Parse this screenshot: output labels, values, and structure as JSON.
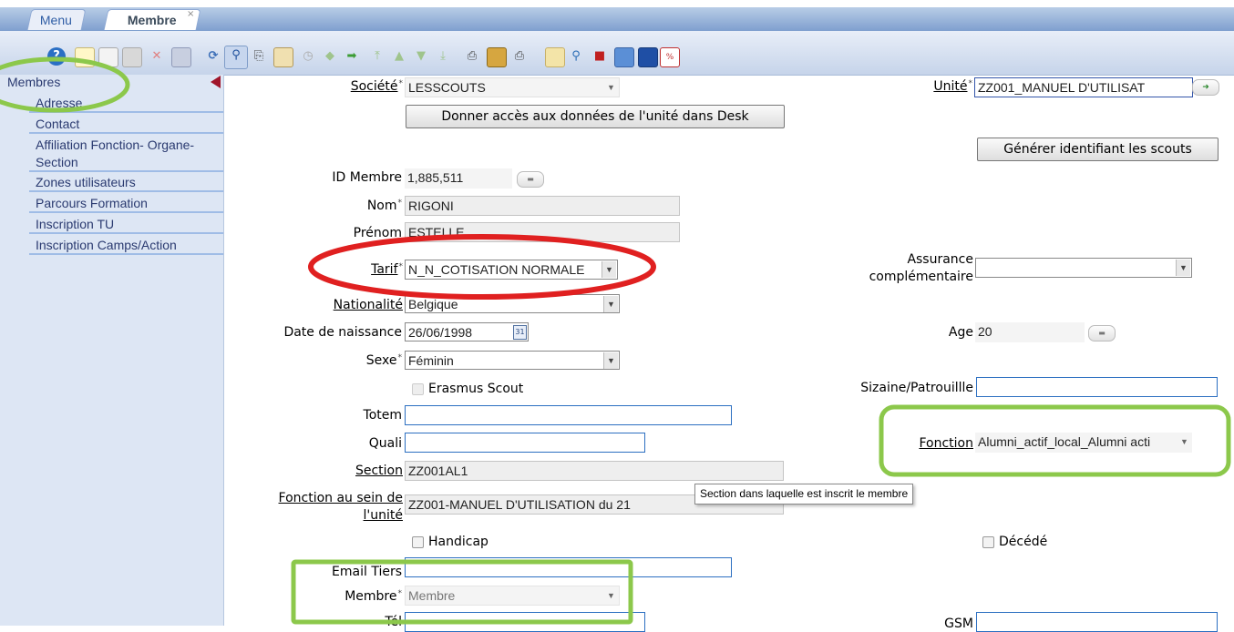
{
  "tabs": {
    "menu": "Menu",
    "active": "Membre",
    "close": "×"
  },
  "toolbar": {
    "icons": [
      "help-icon",
      "new-icon",
      "copy-icon",
      "edit-icon",
      "delete-icon",
      "save-icon",
      "refresh-icon",
      "search-icon",
      "attach-icon",
      "table-icon",
      "clock-icon",
      "prev-icon",
      "next-icon",
      "first-icon",
      "up-icon",
      "down-icon",
      "last-icon",
      "print-icon",
      "report-icon",
      "print2-icon",
      "lock-icon",
      "zoom-icon",
      "export-icon",
      "chart-icon",
      "book-icon",
      "pdf-icon"
    ]
  },
  "sidebar": {
    "header": "Membres",
    "items": [
      "Adresse",
      "Contact",
      "Affiliation Fonction- Organe-",
      "Section",
      "Zones utilisateurs",
      "Parcours Formation",
      "Inscription TU",
      "Inscription Camps/Action"
    ]
  },
  "form": {
    "societe": {
      "label": "Société",
      "value": "LESSCOUTS"
    },
    "unite": {
      "label": "Unité",
      "value": "ZZ001_MANUEL D'UTILISAT"
    },
    "donner_button": "Donner accès aux données de l'unité dans Desk",
    "generer_button": "Générer identifiant les scouts",
    "id_membre": {
      "label": "ID Membre",
      "value": "1,885,511"
    },
    "nom": {
      "label": "Nom",
      "value": "RIGONI"
    },
    "prenom": {
      "label": "Prénom",
      "value": "ESTELLE"
    },
    "tarif": {
      "label": "Tarif",
      "value": "N_N_COTISATION NORMALE"
    },
    "assurance": {
      "label_1": "Assurance",
      "label_2": "complémentaire",
      "value": ""
    },
    "nationalite": {
      "label": "Nationalité",
      "value": "Belgique"
    },
    "date_naissance": {
      "label": "Date de naissance",
      "value": "26/06/1998"
    },
    "age": {
      "label": "Age",
      "value": "20"
    },
    "sexe": {
      "label": "Sexe",
      "value": "Féminin"
    },
    "erasmus": {
      "label": "Erasmus Scout",
      "checked": false
    },
    "sizaine": {
      "label": "Sizaine/Patrouillle",
      "value": ""
    },
    "totem": {
      "label": "Totem",
      "value": ""
    },
    "quali": {
      "label": "Quali",
      "value": ""
    },
    "fonction": {
      "label": "Fonction",
      "value": "Alumni_actif_local_Alumni acti"
    },
    "section": {
      "label": "Section",
      "value": "ZZ001AL1"
    },
    "section_tooltip": "Section dans laquelle est inscrit le membre",
    "fonction_unite": {
      "label_1": "Fonction au sein de",
      "label_2": "l'unité",
      "value": "ZZ001-MANUEL D'UTILISATION du 21"
    },
    "handicap": {
      "label": "Handicap",
      "checked": false
    },
    "decede": {
      "label": "Décédé",
      "checked": false
    },
    "email": {
      "label": "Email Tiers",
      "value": ""
    },
    "membre": {
      "label": "Membre",
      "value": "Membre"
    },
    "tel": {
      "label": "Tél",
      "value": ""
    },
    "gsm": {
      "label": "GSM",
      "value": ""
    },
    "required_mark": "*"
  },
  "colors": {
    "highlight_green": "#8cc84b",
    "highlight_red": "#e02020",
    "link_blue": "#2a3a70"
  }
}
